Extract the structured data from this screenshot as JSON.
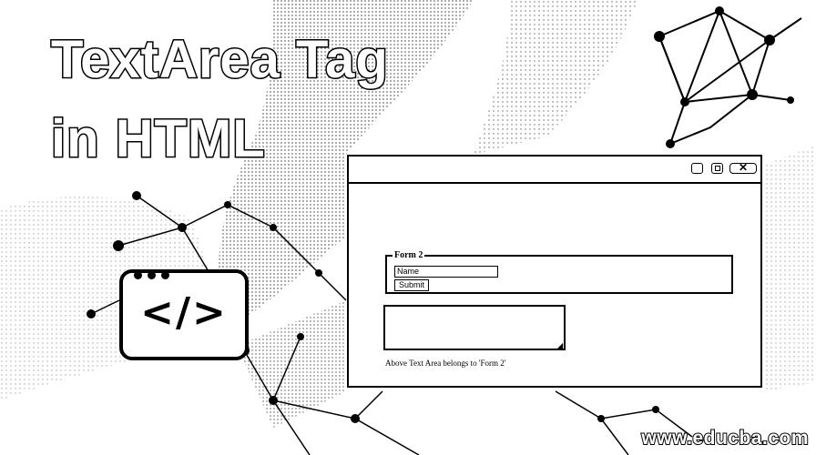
{
  "title": {
    "line1": "TextArea Tag",
    "line2": "in HTML"
  },
  "code_tile": {
    "glyph": "</>",
    "icon": "code-icon"
  },
  "browser_window": {
    "controls": [
      "minimize-icon",
      "maximize-icon",
      "close-icon"
    ],
    "close_glyph": "✕",
    "form": {
      "legend": "Form 2",
      "input_value": "Name",
      "submit_label": "Submit"
    },
    "caption": "Above Text Area belongs to 'Form 2'"
  },
  "website": "www.educba.com"
}
